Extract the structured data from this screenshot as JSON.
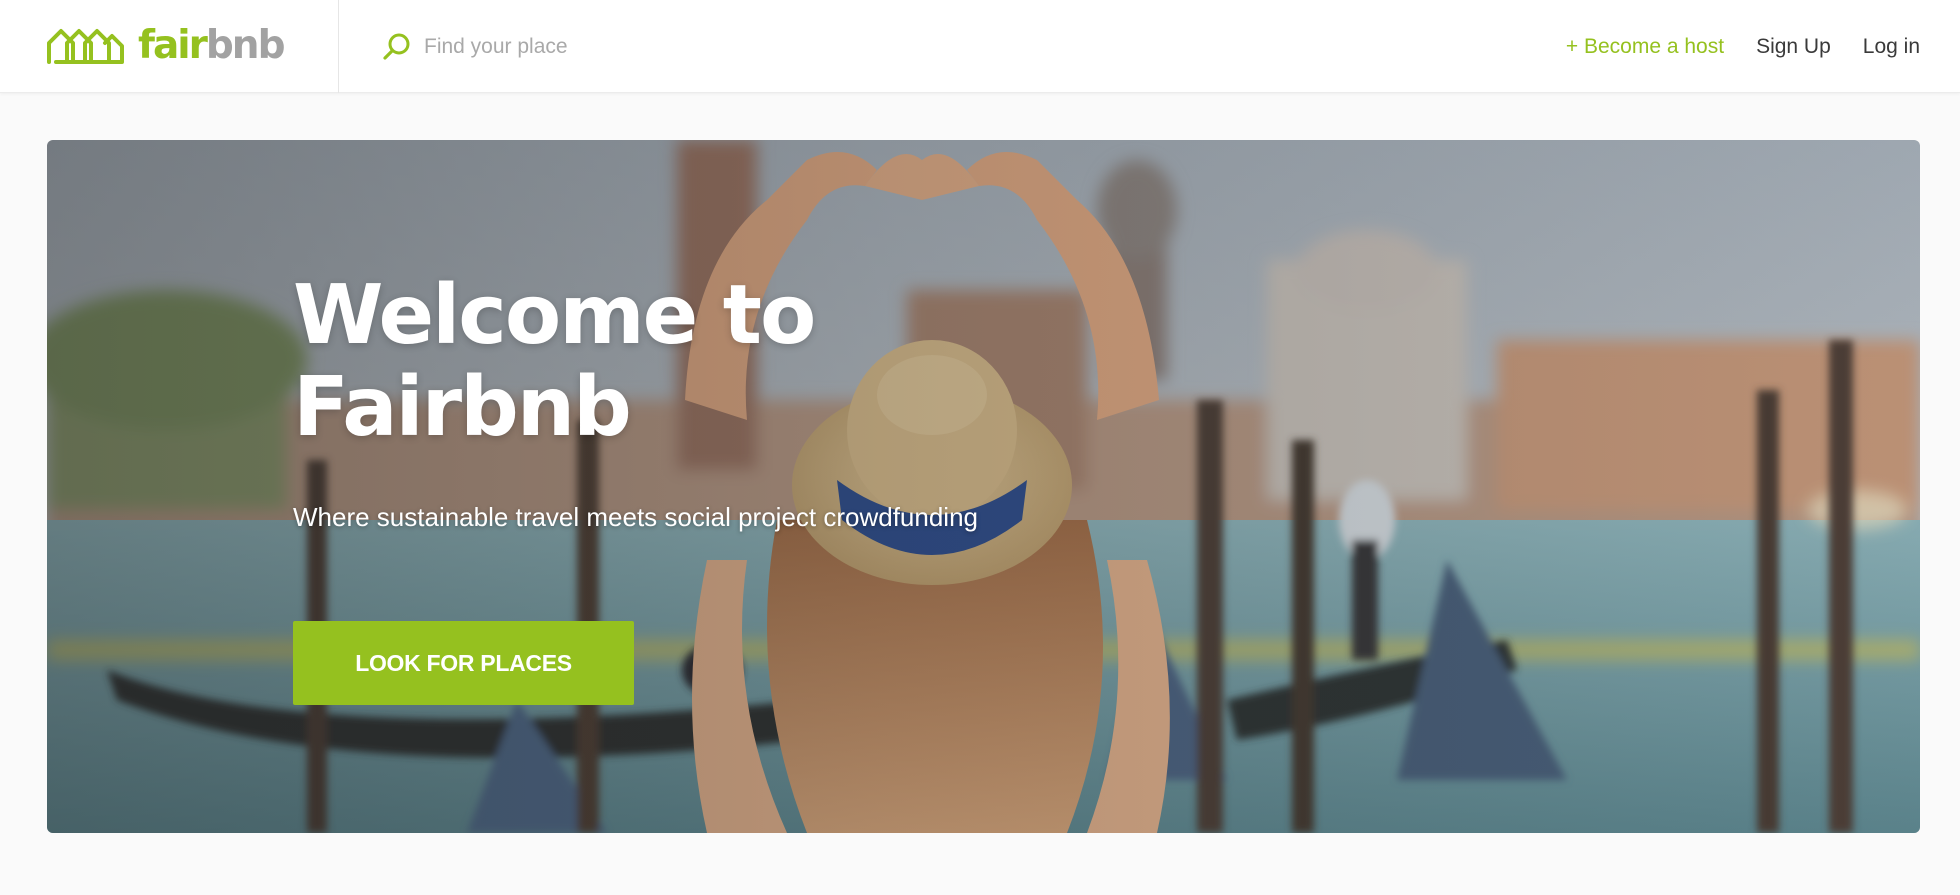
{
  "brand": {
    "logo_word_1": "fair",
    "logo_word_2": "bnb",
    "accent_color": "#95c11f",
    "muted_color": "#a2a2a2",
    "logo_icon": "houses-icon"
  },
  "search": {
    "icon": "search-icon",
    "placeholder": "Find your place",
    "value": ""
  },
  "nav": {
    "become_host": "+ Become a host",
    "sign_up": "Sign Up",
    "log_in": "Log in"
  },
  "hero": {
    "title_line_1": "Welcome to",
    "title_line_2": "Fairbnb",
    "subtitle": "Where sustainable travel meets social project crowdfunding",
    "cta_label": "LOOK FOR PLACES",
    "image_description_icon": "venice-canal-photo"
  }
}
